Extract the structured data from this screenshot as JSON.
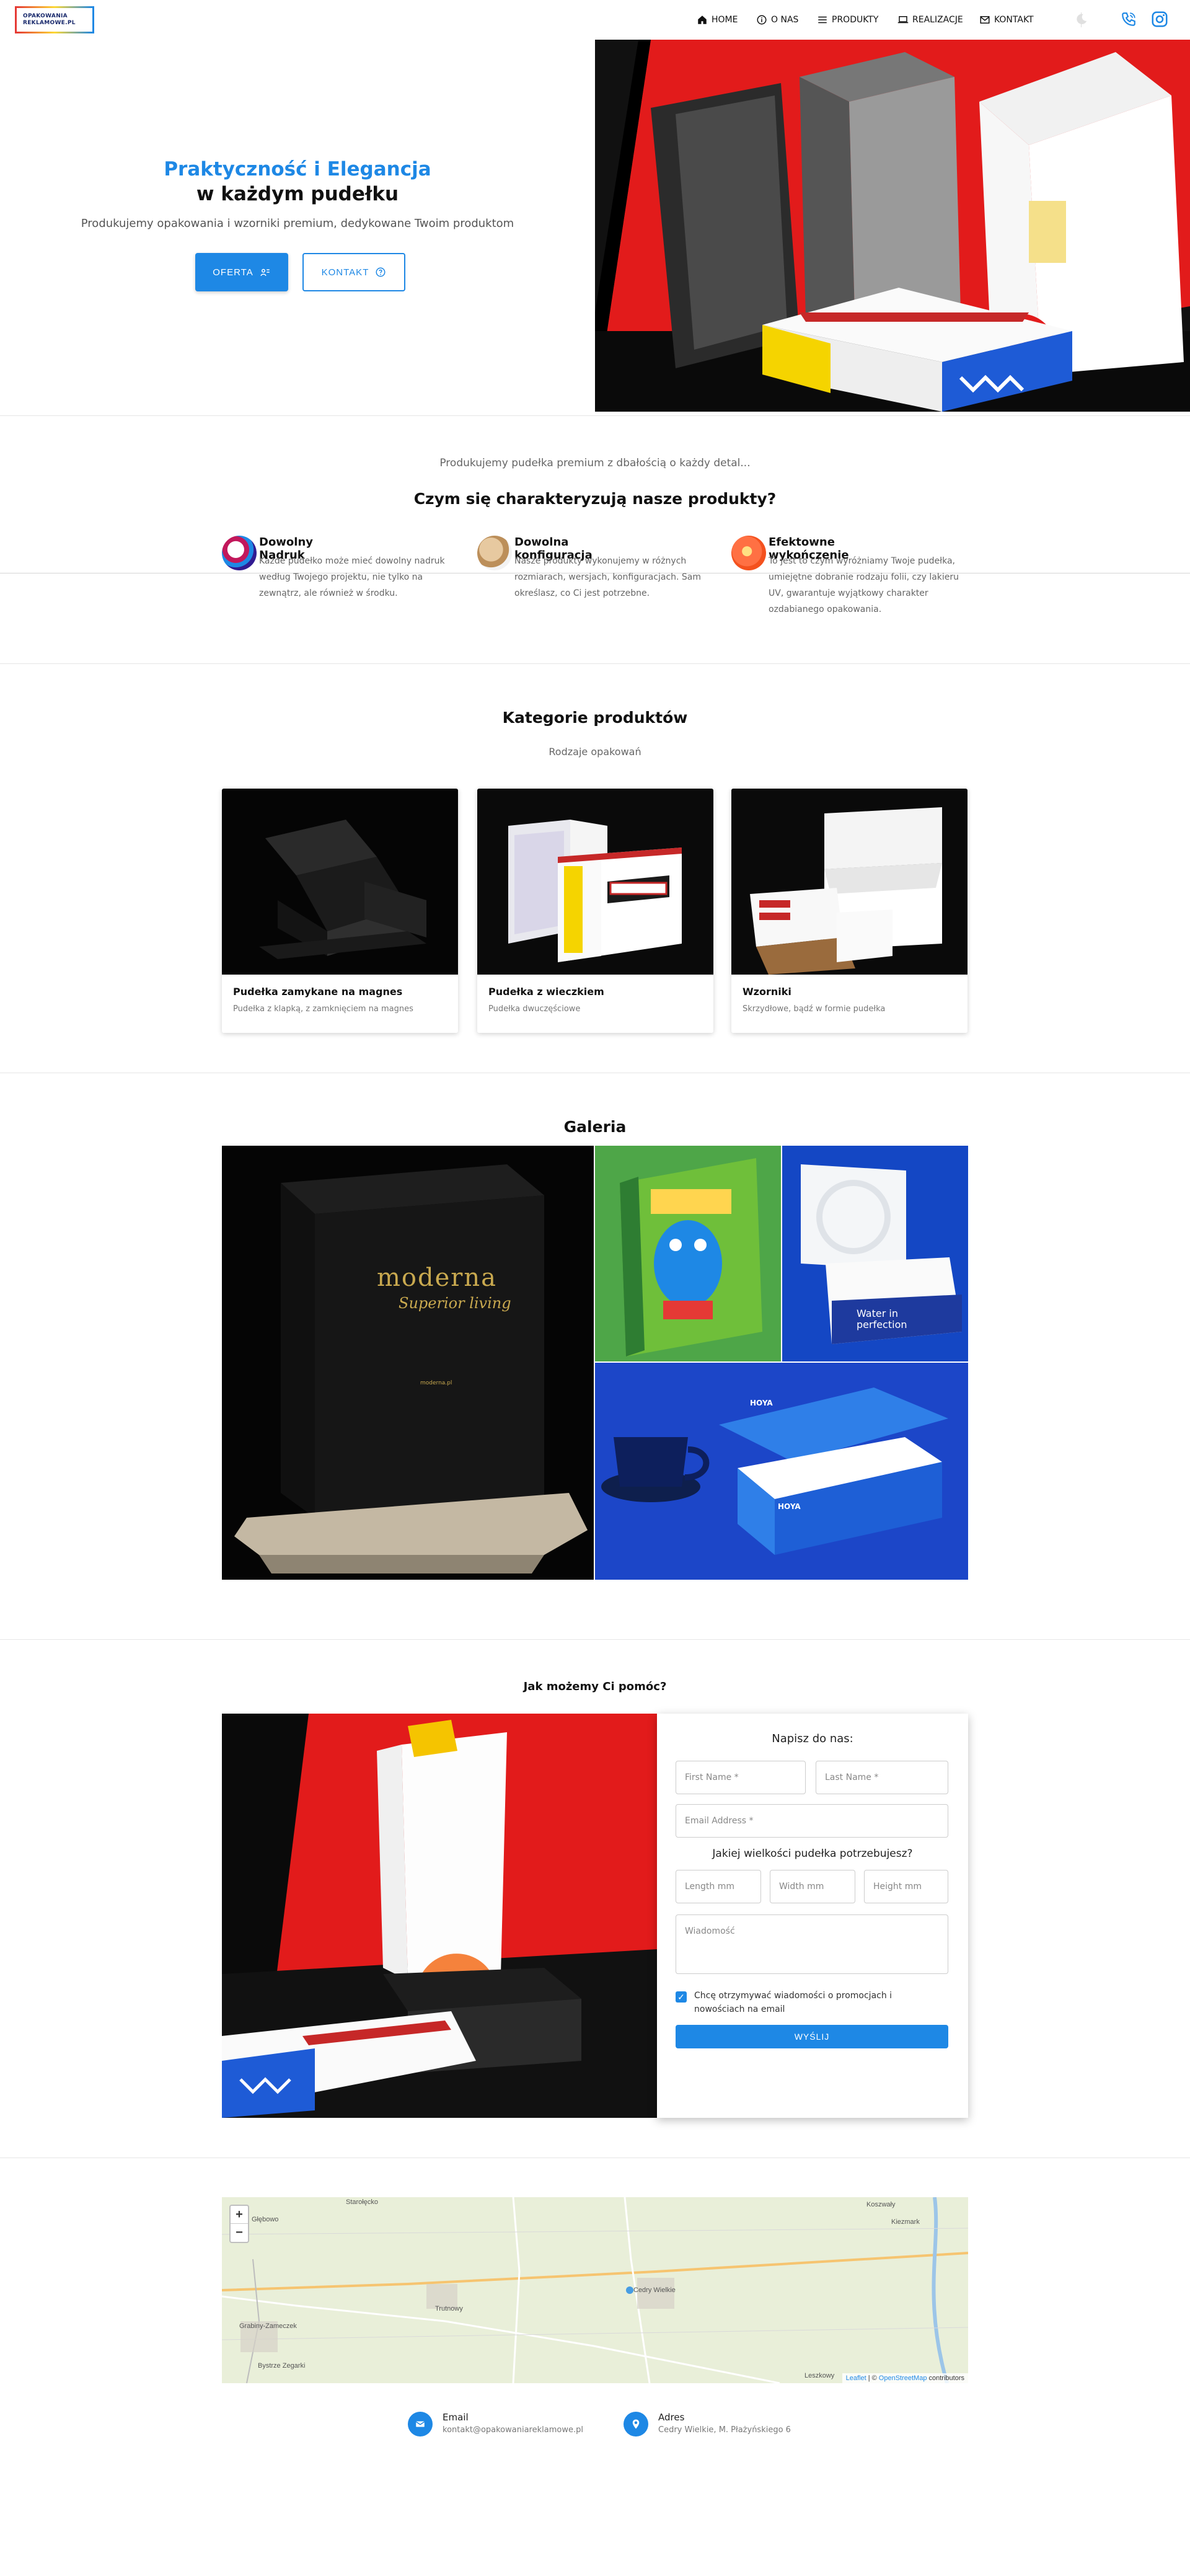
{
  "header": {
    "logo_line1": "OPAKOWANIA",
    "logo_line2": "REKLAMOWE.PL",
    "nav": [
      {
        "label": "HOME",
        "icon": "home-icon"
      },
      {
        "label": "O NAS",
        "icon": "info-icon"
      },
      {
        "label": "PRODUKTY",
        "icon": "list-icon"
      },
      {
        "label": "REALIZACJE",
        "icon": "laptop-icon"
      },
      {
        "label": "KONTAKT",
        "icon": "mail-icon"
      }
    ],
    "extra_icons": [
      "moon-icon",
      "phone-icon",
      "instagram-icon"
    ]
  },
  "hero": {
    "title_line1": "Praktyczność i Elegancja",
    "title_line2": "w każdym pudełku",
    "subtitle": "Produkujemy opakowania i wzorniki premium, dedykowane Twoim produktom",
    "btn_offer": "OFERTA",
    "btn_contact": "KONTAKT"
  },
  "features": {
    "intro": "Produkujemy pudełka premium z dbałością o każdy detal...",
    "title": "Czym się charakteryzują nasze produkty?",
    "items": [
      {
        "title": "Dowolny Nadruk",
        "text": "Każde pudełko może mieć dowolny nadruk według Twojego projektu, nie tylko na zewnątrz, ale również w środku."
      },
      {
        "title": "Dowolna konfiguracja",
        "text": "Nasze produkty wykonujemy w różnych rozmiarach, wersjach, konfiguracjach. Sam określasz, co Ci jest potrzebne."
      },
      {
        "title": "Efektowne wykończenie",
        "text": "To jest to czym wyróżniamy Twoje pudełka, umiejętne dobranie rodzaju folii, czy lakieru UV, gwarantuje wyjątkowy charakter ozdabianego opakowania."
      }
    ]
  },
  "categories": {
    "title": "Kategorie produktów",
    "subtitle": "Rodzaje opakowań",
    "items": [
      {
        "title": "Pudełka zamykane na magnes",
        "desc": "Pudełka z klapką, z zamknięciem na magnes"
      },
      {
        "title": "Pudełka z wieczkiem",
        "desc": "Pudełka dwuczęściowe"
      },
      {
        "title": "Wzorniki",
        "desc": "Skrzydłowe, bądź w formie pudełka"
      }
    ]
  },
  "gallery": {
    "title": "Galeria",
    "moderna_text1": "moderna",
    "moderna_text2": "Superior living",
    "moderna_small": "moderna.pl",
    "water_text1": "Water in",
    "water_text2": "perfection",
    "hoya_text": "HOYA"
  },
  "contact": {
    "title": "Jak możemy Ci pomóc?",
    "form_title": "Napisz do nas:",
    "first_name": "First Name *",
    "last_name": "Last Name *",
    "email": "Email Address *",
    "size_question": "Jakiej wielkości pudełka potrzebujesz?",
    "length": "Length mm",
    "width": "Width mm",
    "height": "Height mm",
    "message": "Wiadomość",
    "consent": "Chcę otrzymywać wiadomości o promocjach i nowościach na email",
    "send": "WYŚLIJ"
  },
  "map": {
    "zoom_in": "+",
    "zoom_out": "−",
    "attribution_leaflet": "Leaflet",
    "attribution_sep": "| ©",
    "attribution_osm": "OpenStreetMap",
    "attribution_rest": "contributors",
    "places": [
      "Starołęcko",
      "Głębowo",
      "Cedry Wielkie",
      "Trutnowy",
      "Koszwały",
      "Leszkowy",
      "Kiezmark",
      "Grabiny-Zameczek",
      "Bystrze Zegarki"
    ]
  },
  "footer": {
    "email_label": "Email",
    "email_value": "kontakt@opakowaniareklamowe.pl",
    "address_label": "Adres",
    "address_value": "Cedry Wielkie, M. Płażyńskiego 6"
  },
  "colors": {
    "accent": "#1e88e5",
    "red": "#e53935",
    "yellow": "#fdd835"
  }
}
